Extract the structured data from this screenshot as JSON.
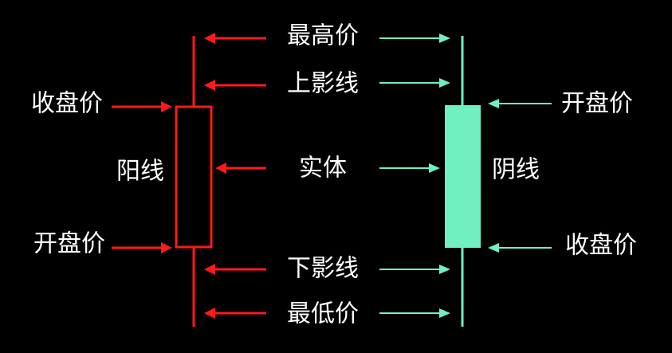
{
  "colors": {
    "background": "#000000",
    "bullish": "#ff1a1a",
    "bearish": "#70f0c0",
    "text": "#ffffff"
  },
  "labels": {
    "high": "最高价",
    "upper_shadow": "上影线",
    "body": "实体",
    "lower_shadow": "下影线",
    "low": "最低价",
    "bull_close": "收盘价",
    "bull_open": "开盘价",
    "bull_name": "阳线",
    "bear_open": "开盘价",
    "bear_close": "收盘价",
    "bear_name": "阴线"
  }
}
